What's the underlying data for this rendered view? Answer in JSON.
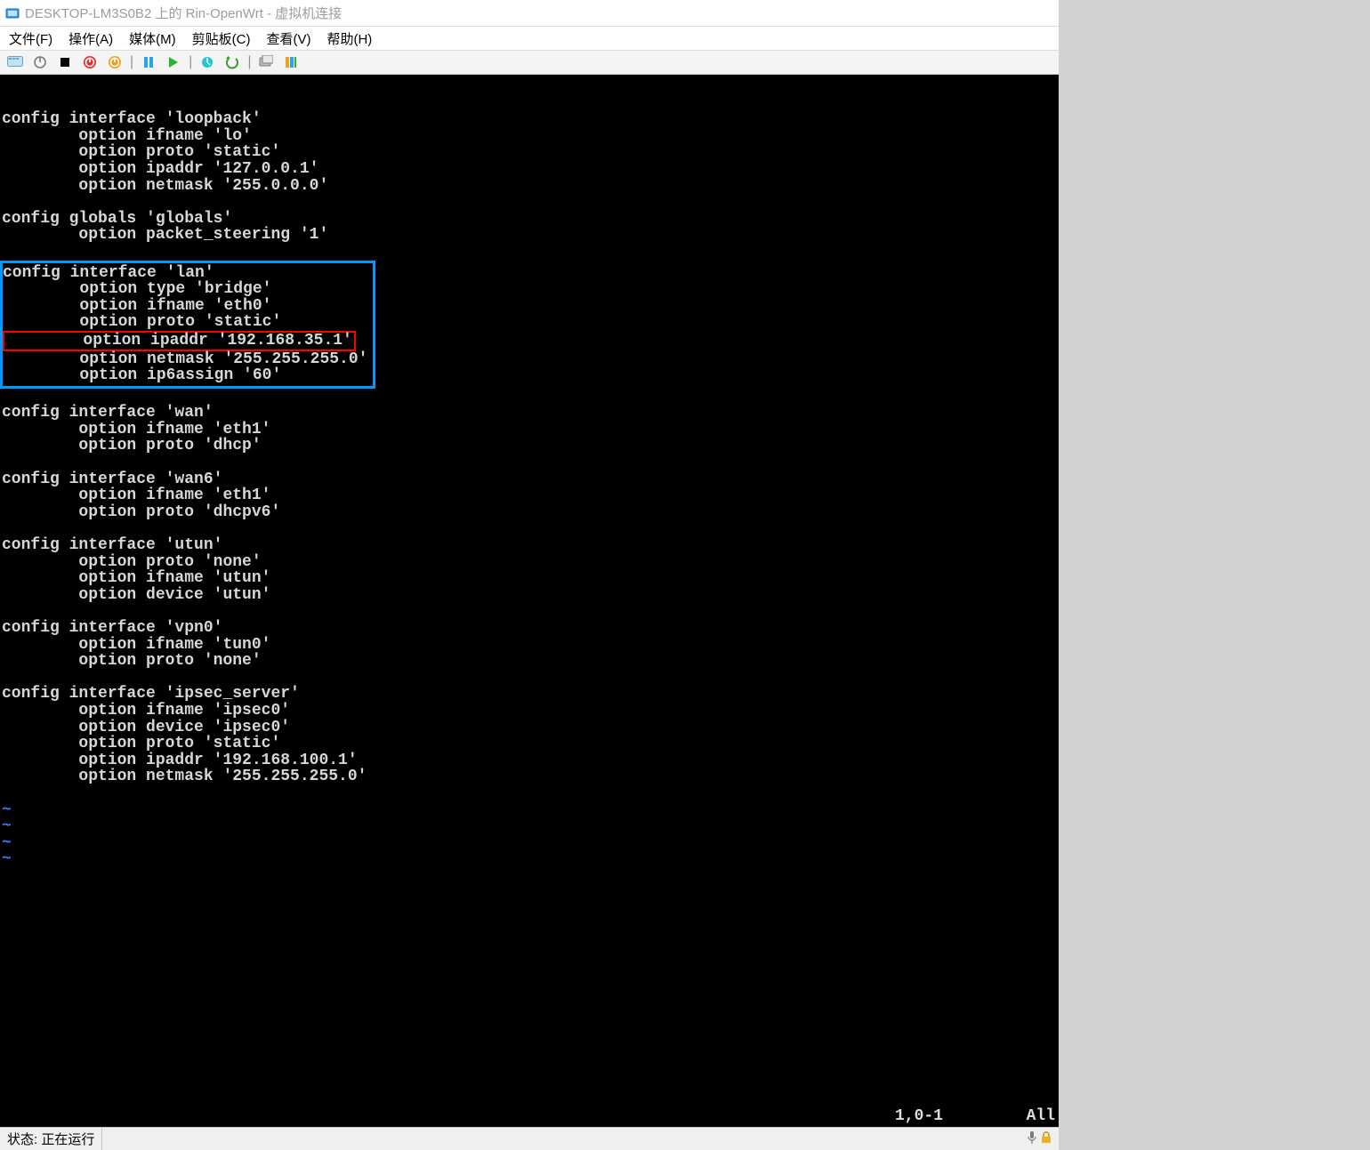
{
  "window": {
    "title": "DESKTOP-LM3S0B2 上的 Rin-OpenWrt - 虚拟机连接"
  },
  "menubar": {
    "file": "文件(F)",
    "action": "操作(A)",
    "media": "媒体(M)",
    "clipboard": "剪贴板(C)",
    "view": "查看(V)",
    "help": "帮助(H)"
  },
  "toolbar": {
    "icons": [
      "ctrl_alt_del",
      "power_gray",
      "stop",
      "shutdown_red",
      "reset_orange",
      "pause_blue",
      "start_green",
      "snapshot",
      "revert",
      "enhanced1",
      "share"
    ]
  },
  "config": {
    "loopback": {
      "header": "config interface 'loopback'",
      "ifname": "        option ifname 'lo'",
      "proto": "        option proto 'static'",
      "ipaddr": "        option ipaddr '127.0.0.1'",
      "netmask": "        option netmask '255.0.0.0'"
    },
    "globals": {
      "header": "config globals 'globals'",
      "pkt": "        option packet_steering '1'"
    },
    "lan": {
      "header": "config interface 'lan'",
      "type": "        option type 'bridge'",
      "ifname": "        option ifname 'eth0'",
      "proto": "        option proto 'static'",
      "ipaddr": "        option ipaddr '192.168.35.1'",
      "netmask": "        option netmask '255.255.255.0'",
      "ip6assign": "        option ip6assign '60'"
    },
    "wan": {
      "header": "config interface 'wan'",
      "ifname": "        option ifname 'eth1'",
      "proto": "        option proto 'dhcp'"
    },
    "wan6": {
      "header": "config interface 'wan6'",
      "ifname": "        option ifname 'eth1'",
      "proto": "        option proto 'dhcpv6'"
    },
    "utun": {
      "header": "config interface 'utun'",
      "proto": "        option proto 'none'",
      "ifname": "        option ifname 'utun'",
      "device": "        option device 'utun'"
    },
    "vpn0": {
      "header": "config interface 'vpn0'",
      "ifname": "        option ifname 'tun0'",
      "proto": "        option proto 'none'"
    },
    "ipsec": {
      "header": "config interface 'ipsec_server'",
      "ifname": "        option ifname 'ipsec0'",
      "device": "        option device 'ipsec0'",
      "proto": "        option proto 'static'",
      "ipaddr": "        option ipaddr '192.168.100.1'",
      "netmask": "        option netmask '255.255.255.0'"
    }
  },
  "tilde": "~",
  "vim_status": {
    "left": "",
    "pos": "1,0-1",
    "right": "All"
  },
  "statusbar": {
    "state": "状态: 正在运行"
  }
}
